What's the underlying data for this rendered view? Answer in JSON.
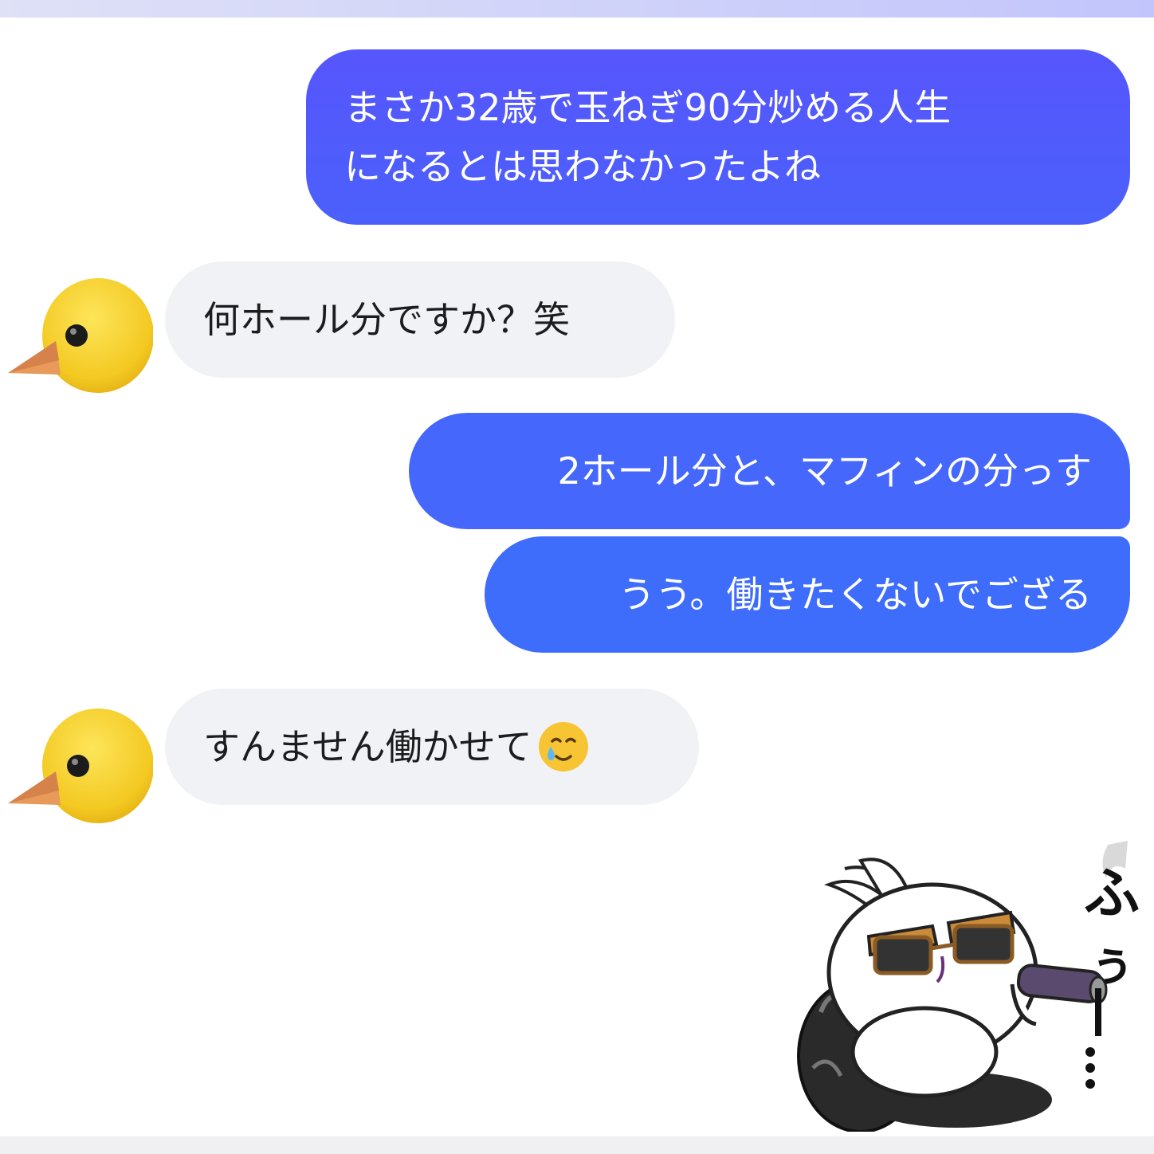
{
  "messages": [
    {
      "side": "outgoing",
      "lines": [
        "まさか32歳で玉ねぎ90分炒める人生",
        "になるとは思わなかったよね"
      ]
    },
    {
      "side": "incoming",
      "text": "何ホール分ですか？笑"
    },
    {
      "side": "outgoing",
      "text": "2ホール分と、マフィンの分っす"
    },
    {
      "side": "outgoing",
      "text": "うう。働きたくないでござる"
    },
    {
      "side": "incoming",
      "text": "すんません働かせて",
      "emoji": "smiling-face-with-tear-icon"
    }
  ],
  "sticker": {
    "text": "ふぅ・・・",
    "icon": "rabbit-sunglasses-cigar-sticker"
  },
  "avatar": {
    "icon": "baby-chick-icon"
  },
  "colors": {
    "outgoing_bubble": "#4c5ffb",
    "incoming_bubble": "#f1f2f6",
    "avatar_yellow": "#f6cf2c"
  }
}
